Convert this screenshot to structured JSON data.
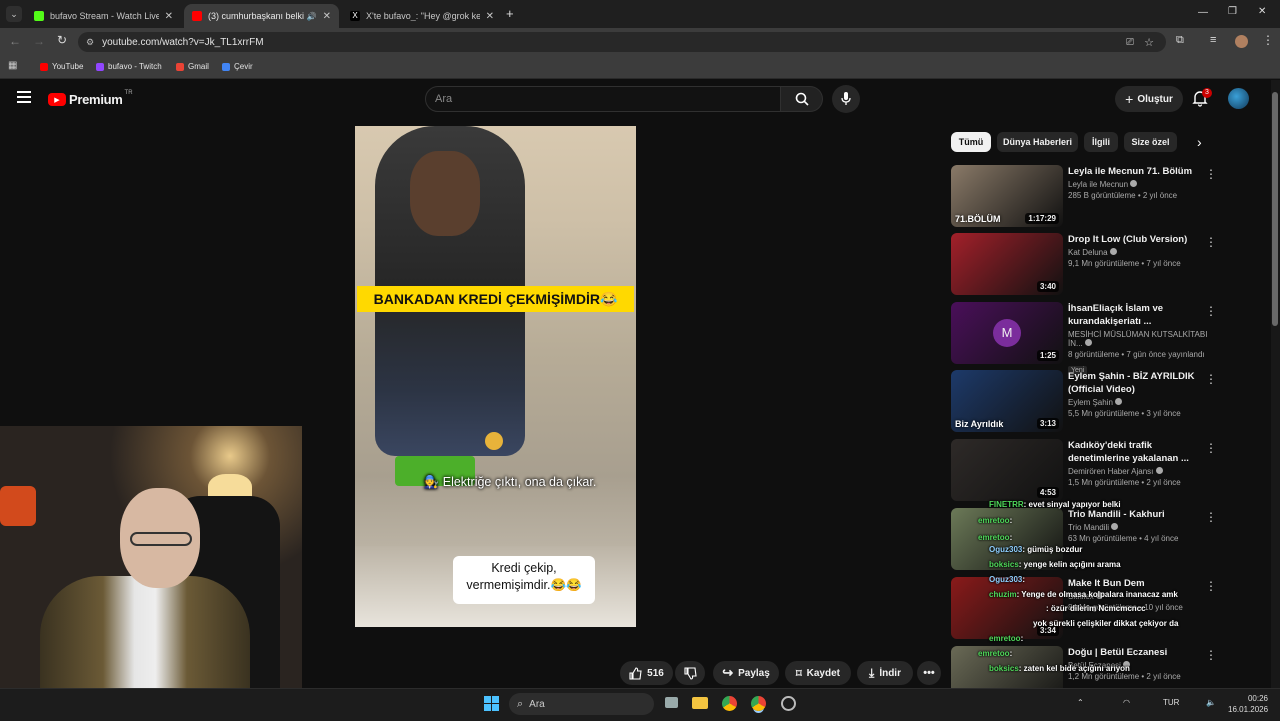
{
  "browser": {
    "tabs": [
      {
        "title": "bufavo Stream - Watch Live on",
        "favicon_color": "#53fc18",
        "active": false
      },
      {
        "title": "(3) cumhurbaşkanı belki af",
        "favicon_color": "#ff0000",
        "active": true
      },
      {
        "title": "X'te bufavo_: \"Hey @grok kend",
        "favicon_color": "#e6e6e6",
        "active": false
      }
    ],
    "new_tab": "+",
    "url": "youtube.com/watch?v=Jk_TL1xrrFM",
    "bookmarks": [
      {
        "label": "YouTube",
        "color": "#ff0000"
      },
      {
        "label": "bufavo - Twitch",
        "color": "#9146ff"
      },
      {
        "label": "Gmail",
        "color": "#ea4335"
      },
      {
        "label": "Çevir",
        "color": "#4285f4"
      }
    ]
  },
  "youtube": {
    "logo": "Premium",
    "region": "TR",
    "search_placeholder": "Ara",
    "create_label": "Oluştur",
    "notif_count": "3"
  },
  "video": {
    "captions": [
      "BANKADAN KREDİ ÇEKMİŞİMDİR😂",
      "🧑‍🔧 Elektriğe çıktı, ona da çıkar.",
      "Kredi çekip,",
      "vermemişimdir.😂😂"
    ]
  },
  "actions": {
    "likes": "516",
    "share": "Paylaş",
    "save": "Kaydet",
    "download": "İndir"
  },
  "chips": [
    "Tümü",
    "Dünya Haberleri",
    "İlgili",
    "Size özel"
  ],
  "recommendations": [
    {
      "title": "Leyla ile Mecnun 71. Bölüm",
      "channel": "Leyla ile Mecnun",
      "views": "285 B görüntüleme • 2 yıl önce",
      "duration": "1:17:29",
      "thumb_text": "71.BÖLÜM",
      "color": "#8a7a68"
    },
    {
      "title": "Drop It Low (Club Version)",
      "channel": "Kat Deluna",
      "views": "9,1 Mn görüntüleme • 7 yıl önce",
      "duration": "3:40",
      "thumb_text": "",
      "color": "#a3202a"
    },
    {
      "title": "İhsanEliaçık İslam ve kurandakişeriatı ...",
      "channel": "MESİHCİ MÜSLÜMAN KUTSALKİTABI İN...",
      "views": "8 görüntüleme • 7 gün önce yayınlandı",
      "badge": "Yeni",
      "duration": "1:25",
      "thumb_text": "M",
      "color": "#4a0f5a"
    },
    {
      "title": "Eylem Şahin  - BİZ AYRILDIK (Official Video)",
      "channel": "Eylem Şahin",
      "views": "5,5 Mn görüntüleme • 3 yıl önce",
      "duration": "3:13",
      "thumb_text": "Biz Ayrıldık",
      "color": "#1d3a6a"
    },
    {
      "title": "Kadıköy'deki trafik denetimlerine yakalanan ...",
      "channel": "Demirören Haber Ajansı",
      "views": "1,5 Mn görüntüleme • 2 yıl önce",
      "duration": "4:53",
      "thumb_text": "",
      "color": "#2e2a28"
    },
    {
      "title": "Trio Mandili - Kakhuri",
      "channel": "Trio Mandili",
      "views": "63 Mn görüntüleme • 4 yıl önce",
      "duration": "",
      "thumb_text": "",
      "color": "#6c7a58"
    },
    {
      "title": "Make It Bun Dem",
      "channel": "Skrillex",
      "views": "84 Mn görüntüleme • 10 yıl önce",
      "duration": "3:34",
      "thumb_text": "",
      "color": "#8a1a1a"
    },
    {
      "title": "Doğu | Betül Eczanesi",
      "channel": "Betül Eczanesi",
      "views": "1,2 Mn görüntüleme • 2 yıl önce",
      "duration": "",
      "thumb_text": "",
      "color": "#6a6a56"
    }
  ],
  "chat": [
    {
      "user": "FINETRR",
      "msg": ": evet sinyal yapıyor belki"
    },
    {
      "user": "emretoo",
      "msg": ":"
    },
    {
      "user": "emretoo",
      "msg": ":"
    },
    {
      "user": "Oguz303",
      "msg": ": gümüş bozdur"
    },
    {
      "user": "boksics",
      "msg": ": yenge kelin açığını arama"
    },
    {
      "user": "Oguz303",
      "msg": ":"
    },
    {
      "user": "chuzim",
      "msg": ": Yenge de olmasa kolpalara inanacaz amk"
    },
    {
      "user": "",
      "msg": ": özür dilerim Ncmcmcncc"
    },
    {
      "user": "emretoo",
      "msg": ":"
    },
    {
      "user": "",
      "msg": "yok sürekli çelişkiler dikkat çekiyor da"
    },
    {
      "user": "emretoo",
      "msg": ":"
    },
    {
      "user": "boksics",
      "msg": ": zaten kel bide açığını arıyon"
    },
    {
      "user": "Oguz303",
      "msg": ":"
    },
    {
      "user": "Oguz303",
      "msg": ": DEĞĞĞ"
    }
  ],
  "taskbar": {
    "search": "Ara",
    "lang": "TUR",
    "time": "00:26",
    "date": "16.01.2026"
  }
}
